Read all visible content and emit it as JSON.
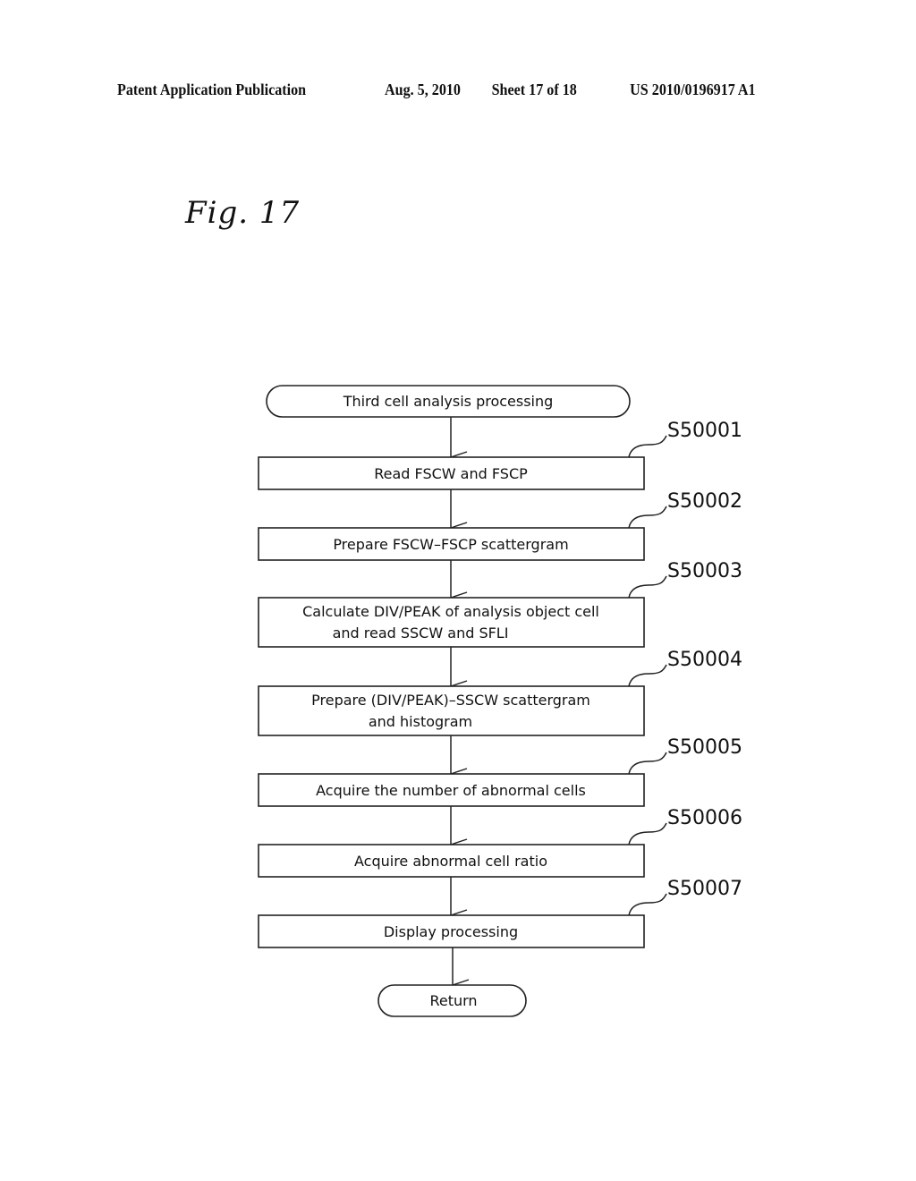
{
  "header": {
    "publication": "Patent Application Publication",
    "date": "Aug. 5, 2010",
    "sheet": "Sheet 17 of 18",
    "number": "US 2010/0196917 A1"
  },
  "figure": {
    "label": "Fig. 17"
  },
  "flowchart": {
    "start": "Third cell analysis processing",
    "steps": [
      {
        "id": "S50001",
        "lines": [
          "Read FSCW and FSCP"
        ]
      },
      {
        "id": "S50002",
        "lines": [
          "Prepare FSCW–FSCP scattergram"
        ]
      },
      {
        "id": "S50003",
        "lines": [
          "Calculate DIV/PEAK of analysis object cell",
          "and read SSCW and SFLI"
        ]
      },
      {
        "id": "S50004",
        "lines": [
          "Prepare (DIV/PEAK)–SSCW scattergram",
          "and histogram"
        ]
      },
      {
        "id": "S50005",
        "lines": [
          "Acquire the number of abnormal cells"
        ]
      },
      {
        "id": "S50006",
        "lines": [
          "Acquire abnormal cell ratio"
        ]
      },
      {
        "id": "S50007",
        "lines": [
          "Display processing"
        ]
      }
    ],
    "end": "Return"
  }
}
